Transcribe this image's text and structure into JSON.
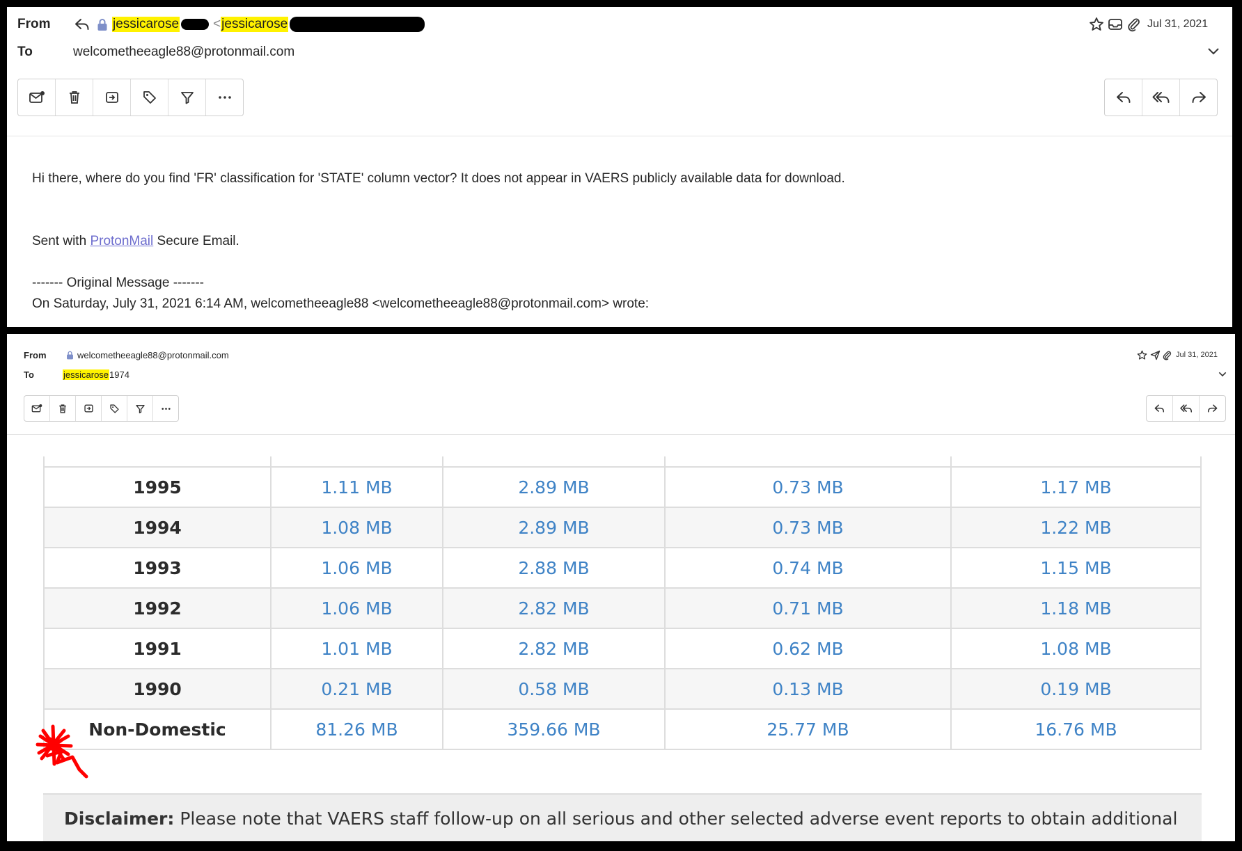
{
  "top_email": {
    "from_label": "From",
    "to_label": "To",
    "from_name": "jessicarose",
    "from_lt": "<",
    "from_address_start": "jessicarose",
    "to_address": "welcometheeagle88@protonmail.com",
    "date": "Jul 31, 2021",
    "body_line": "Hi there, where do you find 'FR' classification for 'STATE' column vector? It does not appear in VAERS publicly available data for download.",
    "sent_with_prefix": "Sent with ",
    "sent_with_link": "ProtonMail",
    "sent_with_suffix": " Secure Email.",
    "original_message": "------- Original Message -------",
    "on_line": "On Saturday, July 31, 2021 6:14 AM, welcometheeagle88 <welcometheeagle88@protonmail.com> wrote:"
  },
  "bottom_email": {
    "from_label": "From",
    "to_label": "To",
    "from_address": "welcometheeagle88@protonmail.com",
    "to_name_highlight": "jessicarose",
    "to_name_suffix": "1974",
    "date": "Jul 31, 2021",
    "table": {
      "rows": [
        {
          "year": "1995",
          "c1": "1.11 MB",
          "c2": "2.89 MB",
          "c3": "0.73 MB",
          "c4": "1.17 MB"
        },
        {
          "year": "1994",
          "c1": "1.08 MB",
          "c2": "2.89 MB",
          "c3": "0.73 MB",
          "c4": "1.22 MB"
        },
        {
          "year": "1993",
          "c1": "1.06 MB",
          "c2": "2.88 MB",
          "c3": "0.74 MB",
          "c4": "1.15 MB"
        },
        {
          "year": "1992",
          "c1": "1.06 MB",
          "c2": "2.82 MB",
          "c3": "0.71 MB",
          "c4": "1.18 MB"
        },
        {
          "year": "1991",
          "c1": "1.01 MB",
          "c2": "2.82 MB",
          "c3": "0.62 MB",
          "c4": "1.08 MB"
        },
        {
          "year": "1990",
          "c1": "0.21 MB",
          "c2": "0.58 MB",
          "c3": "0.13 MB",
          "c4": "0.19 MB"
        },
        {
          "year": "Non-Domestic",
          "c1": "81.26 MB",
          "c2": "359.66 MB",
          "c3": "25.77 MB",
          "c4": "16.76 MB"
        }
      ]
    },
    "disclaimer_label": "Disclaimer:",
    "disclaimer_text": " Please note that VAERS staff follow-up on all serious and other selected adverse event reports to obtain additional"
  },
  "icons": {
    "reply": "reply-icon",
    "lock": "lock-icon",
    "star": "star-icon",
    "inbox": "inbox-icon",
    "paperclip": "paperclip-icon",
    "sent": "paper-plane-icon",
    "chevron": "chevron-down-icon",
    "mark_unread": "envelope-dot-icon",
    "trash": "trash-icon",
    "move": "move-to-folder-icon",
    "label": "tag-icon",
    "filter": "filter-icon",
    "more": "more-icon",
    "reply_all": "reply-all-icon",
    "forward": "forward-icon"
  },
  "colors": {
    "highlight": "#fff200",
    "link": "#6d6dce",
    "table_value": "#3f83c6",
    "annotation_red": "#ff0000"
  }
}
